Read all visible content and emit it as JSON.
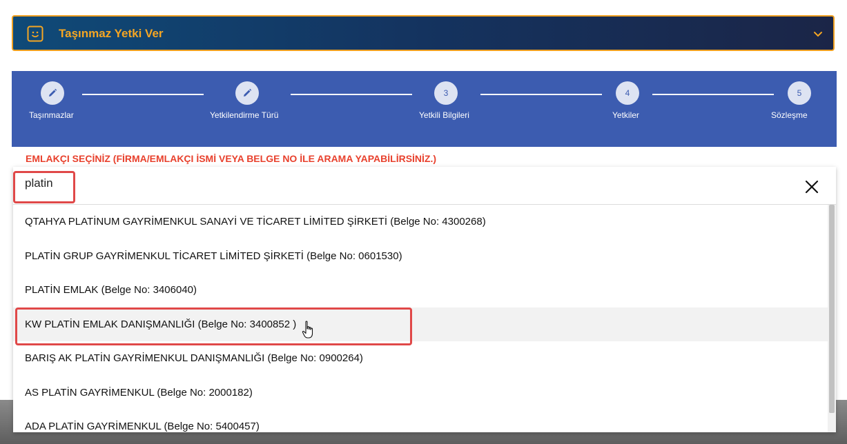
{
  "accordion": {
    "title": "Taşınmaz Yetki Ver",
    "icon": "smiley-icon",
    "chevron": "chevron-down-icon",
    "accent_color": "#f5a623"
  },
  "stepper": {
    "steps": [
      {
        "marker": "",
        "icon": "pencil-icon",
        "label": "Taşınmazlar"
      },
      {
        "marker": "",
        "icon": "pencil-icon",
        "label": "Yetkilendirme Türü"
      },
      {
        "marker": "3",
        "label": "Yetkili Bilgileri"
      },
      {
        "marker": "4",
        "label": "Yetkiler"
      },
      {
        "marker": "5",
        "label": "Sözleşme"
      }
    ]
  },
  "warning": "EMLAKÇI SEÇİNİZ (FİRMA/EMLAKÇI İSMİ VEYA BELGE NO İLE ARAMA YAPABİLİRSİNİZ.)",
  "search": {
    "value": "platin",
    "clear_icon": "close-icon"
  },
  "results": [
    "QTAHYA PLATİNUM GAYRİMENKUL SANAYİ VE TİCARET LİMİTED ŞİRKETİ (Belge No: 4300268)",
    "PLATİN GRUP GAYRİMENKUL TİCARET LİMİTED ŞİRKETİ (Belge No: 0601530)",
    "PLATİN EMLAK (Belge No: 3406040)",
    "KW PLATİN EMLAK DANIŞMANLIĞI (Belge No: 3400852 )",
    "BARIŞ AK PLATİN GAYRİMENKUL DANIŞMANLIĞI (Belge No: 0900264)",
    "AS PLATİN GAYRİMENKUL (Belge No: 2000182)",
    "ADA PLATİN GAYRİMENKUL (Belge No: 5400457)"
  ]
}
